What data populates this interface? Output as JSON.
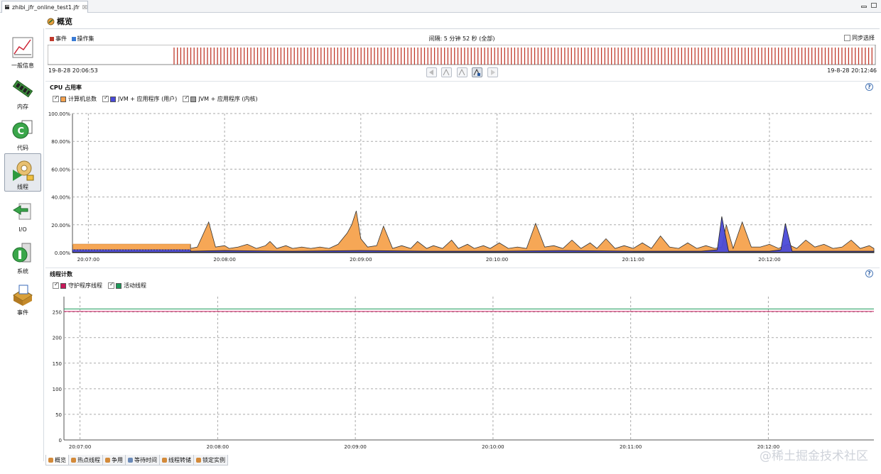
{
  "tab": {
    "file_name": "zhibi_jfr_online_test1.jfr",
    "close_glyph": "☒"
  },
  "page": {
    "title": "概览"
  },
  "sidebar": {
    "items": [
      {
        "label": "一般信息",
        "icon": "general-info-icon"
      },
      {
        "label": "内存",
        "icon": "memory-icon"
      },
      {
        "label": "代码",
        "icon": "code-icon"
      },
      {
        "label": "线程",
        "icon": "threads-icon"
      },
      {
        "label": "I/O",
        "icon": "io-icon"
      },
      {
        "label": "系统",
        "icon": "system-icon"
      },
      {
        "label": "事件",
        "icon": "events-icon"
      }
    ],
    "selected_index": 3
  },
  "timeline": {
    "legend": [
      {
        "label": "事件",
        "color": "#c0392b"
      },
      {
        "label": "操作集",
        "color": "#3a7bd5"
      }
    ],
    "duration_text": "间隔: 5 分钟 52 秒 (全部)",
    "sync_label": "同步选择",
    "sync_checked": false,
    "start_time": "19-8-28 20:06:53",
    "end_time": "19-8-28 20:12:46"
  },
  "cpu_section": {
    "title": "CPU 占用率",
    "help": "?",
    "legend": [
      {
        "label": "计算机总数",
        "checked": true,
        "color": "#f6a24d"
      },
      {
        "label": "JVM + 应用程序 (用户)",
        "checked": true,
        "color": "#4a4ad8"
      },
      {
        "label": "JVM + 应用程序 (内核)",
        "checked": true,
        "color": "#a0a0a0"
      }
    ]
  },
  "thread_section": {
    "title": "线程计数",
    "help": "?",
    "legend": [
      {
        "label": "守护程序线程",
        "checked": true,
        "color": "#c8185a"
      },
      {
        "label": "活动线程",
        "checked": true,
        "color": "#1e9a5a"
      }
    ]
  },
  "chart_data": [
    {
      "type": "area",
      "title": "CPU 占用率",
      "x_tick_labels": [
        "20:07:00",
        "20:08:00",
        "20:09:00",
        "20:10:00",
        "20:11:00",
        "20:12:00"
      ],
      "y_tick_labels": [
        "100.00%",
        "80.00%",
        "60.00%",
        "40.00%",
        "20.00%",
        "0.00%"
      ],
      "ylim": [
        0,
        100
      ],
      "x_range_seconds": [
        -7,
        346
      ],
      "grid": true,
      "series": [
        {
          "name": "计算机总数",
          "color": "#f6a24d",
          "x": [
            -7,
            45,
            45,
            48,
            53,
            56,
            60,
            62,
            66,
            70,
            74,
            78,
            80,
            83,
            87,
            90,
            94,
            98,
            102,
            106,
            110,
            114,
            116,
            118,
            120,
            123,
            127,
            130,
            134,
            138,
            142,
            145,
            149,
            152,
            156,
            160,
            163,
            167,
            170,
            174,
            177,
            181,
            185,
            189,
            193,
            197,
            201,
            205,
            209,
            213,
            217,
            221,
            224,
            228,
            232,
            236,
            240,
            244,
            248,
            252,
            256,
            260,
            264,
            268,
            272,
            276,
            279,
            281,
            284,
            288,
            292,
            296,
            300,
            304,
            308,
            312,
            316,
            320,
            324,
            328,
            332,
            336,
            340,
            344,
            346
          ],
          "y": [
            6,
            6,
            3,
            4,
            22,
            4,
            5,
            3,
            4,
            6,
            3,
            5,
            8,
            3,
            5,
            3,
            4,
            3,
            4,
            3,
            6,
            14,
            20,
            30,
            10,
            4,
            5,
            19,
            3,
            5,
            3,
            8,
            3,
            5,
            3,
            9,
            3,
            6,
            3,
            5,
            3,
            7,
            3,
            4,
            3,
            21,
            4,
            5,
            3,
            9,
            3,
            7,
            3,
            10,
            3,
            5,
            3,
            7,
            3,
            12,
            4,
            3,
            7,
            3,
            5,
            3,
            4,
            20,
            3,
            22,
            4,
            4,
            6,
            3,
            6,
            3,
            9,
            4,
            6,
            3,
            4,
            9,
            3,
            5,
            3
          ]
        },
        {
          "name": "JVM + 应用程序 (用户)",
          "color": "#4a4ad8",
          "x": [
            -7,
            45,
            45,
            60,
            90,
            120,
            150,
            180,
            210,
            240,
            270,
            277,
            279,
            282,
            290,
            300,
            305,
            307,
            310,
            320,
            346
          ],
          "y": [
            2,
            2,
            1,
            1.5,
            1,
            1.5,
            1,
            1,
            1.5,
            1,
            1,
            2,
            26,
            1,
            1,
            1,
            2,
            21,
            1,
            1,
            1
          ]
        },
        {
          "name": "JVM + 应用程序 (内核)",
          "color": "#a0a0a0",
          "x": [
            -7,
            346
          ],
          "y": [
            0.3,
            0.3
          ]
        }
      ]
    },
    {
      "type": "line",
      "title": "线程计数",
      "x_tick_labels": [
        "20:07:00",
        "20:08:00",
        "20:09:00",
        "20:10:00",
        "20:11:00",
        "20:12:00"
      ],
      "y_tick_labels": [
        "250",
        "200",
        "150",
        "100",
        "50",
        "0"
      ],
      "ylim": [
        0,
        280
      ],
      "x_range_seconds": [
        -7,
        346
      ],
      "grid": true,
      "series": [
        {
          "name": "守护程序线程",
          "color": "#c8185a",
          "x": [
            -7,
            346
          ],
          "y": [
            251,
            251
          ]
        },
        {
          "name": "活动线程",
          "color": "#1e9a5a",
          "x": [
            -7,
            346
          ],
          "y": [
            256,
            256
          ]
        }
      ]
    }
  ],
  "bottom_tabs": [
    {
      "label": "概览",
      "selected": true
    },
    {
      "label": "热点线程",
      "selected": false
    },
    {
      "label": "争用",
      "selected": false
    },
    {
      "label": "等待时间",
      "selected": false
    },
    {
      "label": "线程转储",
      "selected": false
    },
    {
      "label": "锁定实例",
      "selected": false
    }
  ],
  "watermark": "@稀土掘金技术社区"
}
